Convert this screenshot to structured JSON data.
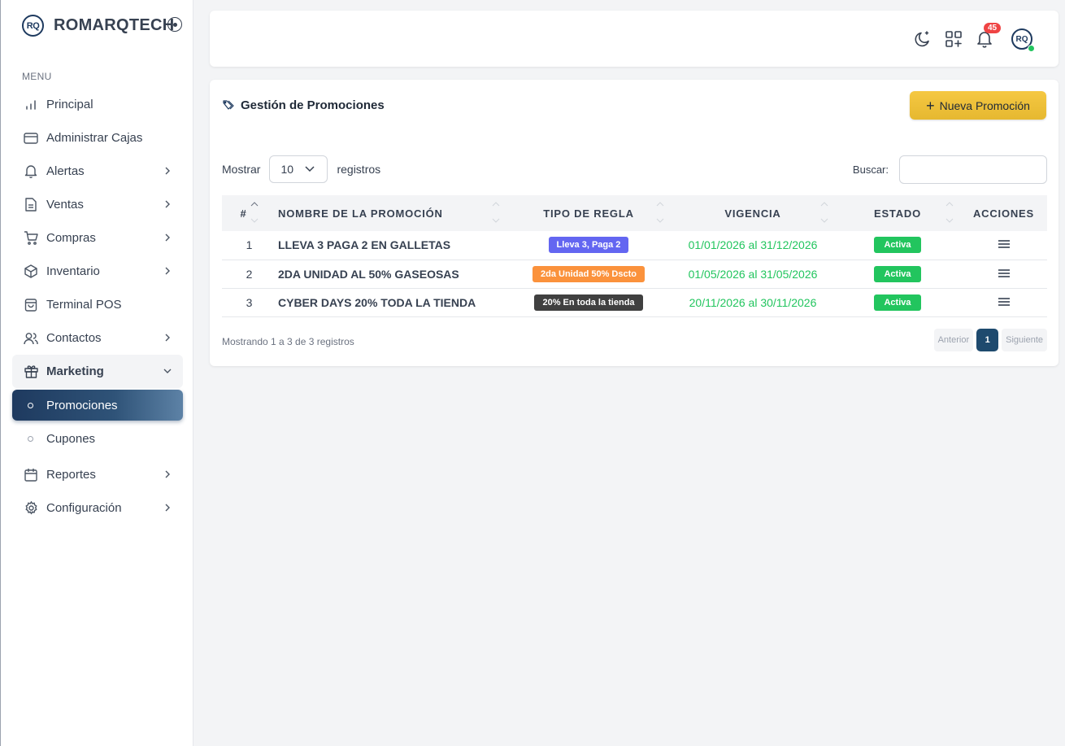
{
  "brand": {
    "logo_text": "RQ",
    "name": "ROMARQTECH"
  },
  "sidebar": {
    "menu_label": "MENU",
    "items": [
      {
        "label": "Principal",
        "icon": "bar-chart-icon",
        "has_chevron": false
      },
      {
        "label": "Administrar Cajas",
        "icon": "credit-card-icon",
        "has_chevron": false
      },
      {
        "label": "Alertas",
        "icon": "bell-icon",
        "has_chevron": true
      },
      {
        "label": "Ventas",
        "icon": "document-icon",
        "has_chevron": true
      },
      {
        "label": "Compras",
        "icon": "cart-icon",
        "has_chevron": true
      },
      {
        "label": "Inventario",
        "icon": "box-icon",
        "has_chevron": true
      },
      {
        "label": "Terminal POS",
        "icon": "bag-icon",
        "has_chevron": false
      },
      {
        "label": "Contactos",
        "icon": "users-icon",
        "has_chevron": true
      },
      {
        "label": "Marketing",
        "icon": "gift-icon",
        "has_chevron": true,
        "open": true
      },
      {
        "label": "Reportes",
        "icon": "calendar-icon",
        "has_chevron": true
      },
      {
        "label": "Configuración",
        "icon": "gear-icon",
        "has_chevron": true
      }
    ],
    "marketing_sub": [
      {
        "label": "Promociones",
        "active": true
      },
      {
        "label": "Cupones",
        "active": false
      }
    ]
  },
  "header": {
    "notifications_count": "45",
    "avatar_text": "RQ"
  },
  "card": {
    "title": "Gestión de Promociones",
    "new_button": "Nueva Promoción",
    "length_prefix": "Mostrar",
    "length_value": "10",
    "length_suffix": "registros",
    "search_label": "Buscar:",
    "search_value": ""
  },
  "table": {
    "columns": [
      "#",
      "NOMBRE DE LA PROMOCIÓN",
      "TIPO DE REGLA",
      "VIGENCIA",
      "ESTADO",
      "ACCIONES"
    ],
    "rows": [
      {
        "num": "1",
        "name": "LLEVA 3 PAGA 2 EN GALLETAS",
        "rule": "Lleva 3, Paga 2",
        "rule_color": "#6366f1",
        "validity": "01/01/2026 al 31/12/2026",
        "status": "Activa"
      },
      {
        "num": "2",
        "name": "2DA UNIDAD AL 50% GASEOSAS",
        "rule": "2da Unidad 50% Dscto",
        "rule_color": "#fb923c",
        "validity": "01/05/2026 al 31/05/2026",
        "status": "Activa"
      },
      {
        "num": "3",
        "name": "CYBER DAYS 20% TODA LA TIENDA",
        "rule": "20% En toda la tienda",
        "rule_color": "#404040",
        "validity": "20/11/2026 al 30/11/2026",
        "status": "Activa"
      }
    ]
  },
  "footer": {
    "info": "Mostrando 1 a 3 de 3 registros",
    "prev": "Anterior",
    "current_page": "1",
    "next": "Siguiente"
  },
  "colors": {
    "brand": "#1e3a5f",
    "accent": "#f5c842",
    "success": "#22c55e",
    "danger": "#ef4444"
  }
}
